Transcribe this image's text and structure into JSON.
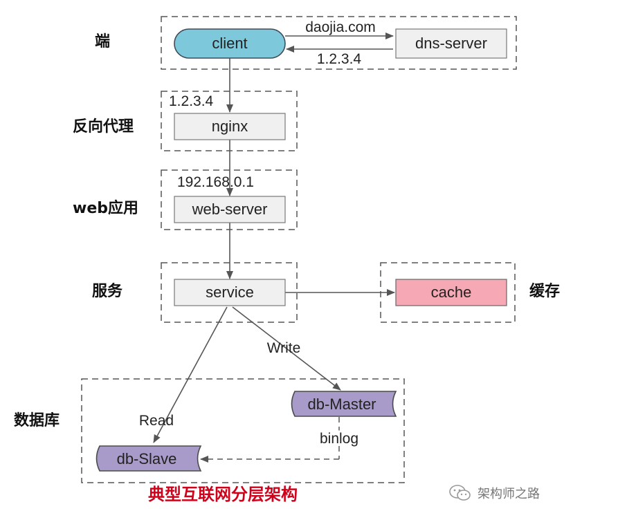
{
  "layers": {
    "client": "端",
    "reverse_proxy": "反向代理",
    "web_app": "web应用",
    "service": "服务",
    "cache": "缓存",
    "database": "数据库"
  },
  "nodes": {
    "client": "client",
    "dns": "dns-server",
    "nginx": "nginx",
    "web": "web-server",
    "service": "service",
    "cache": "cache",
    "master": "db-Master",
    "slave": "db-Slave"
  },
  "edges": {
    "dns_query": "daojia.com",
    "dns_reply": "1.2.3.4",
    "nginx_ip": "1.2.3.4",
    "web_ip": "192.168.0.1",
    "write": "Write",
    "read": "Read",
    "binlog": "binlog"
  },
  "caption": "典型互联网分层架构",
  "watermark": {
    "icon": "wechat-icon",
    "text": "架构师之路"
  },
  "colors": {
    "client": "#7ec8dc",
    "box": "#f0f0f0",
    "cache": "#f6a9b4",
    "db": "#a99bc9",
    "caption": "#d0021b"
  }
}
